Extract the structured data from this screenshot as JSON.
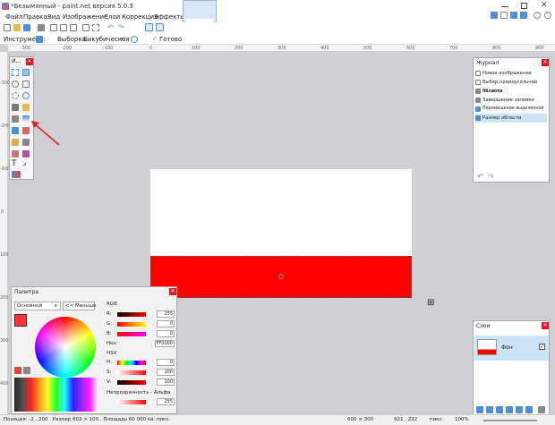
{
  "window": {
    "title": "*Безымянный - paint.net версия 5.0.3"
  },
  "menu": [
    "Файл",
    "Правка",
    "Вид",
    "Изображение",
    "Слои",
    "Коррекция",
    "Эффекты"
  ],
  "toolbar2": {
    "tool_label": "Инструмент:",
    "sampling_label": "Выборка:",
    "sampling_value": "Бикубическая",
    "done_label": "Готово"
  },
  "ruler": {
    "h_ticks": [
      "-300",
      "-200",
      "-100",
      "0",
      "100",
      "200",
      "300",
      "400",
      "500",
      "600",
      "700",
      "800",
      "900"
    ],
    "v_ticks": [
      "-300",
      "-200",
      "-100",
      "0",
      "100",
      "200",
      "300",
      "400",
      "500"
    ]
  },
  "tools": {
    "title": "И..."
  },
  "journal": {
    "title": "Журнал",
    "items": [
      "Новое изображение",
      "Выбор прямоугольной области",
      "Заливка",
      "Завершение заливки",
      "Перемещение выделенной области",
      "Размер области"
    ]
  },
  "layers": {
    "title": "Слои",
    "layer_name": "Фон"
  },
  "palette": {
    "title": "Палитра",
    "mode": "Основной",
    "less_button": "<< Меньше",
    "rgb_label": "RGB",
    "r_label": "R:",
    "r_value": "255",
    "g_label": "G:",
    "g_value": "0",
    "b_label": "B:",
    "b_value": "0",
    "hex_label": "Hex:",
    "hex_value": "FF0000",
    "hsv_label": "HSV",
    "h_label": "H:",
    "h_value": "0",
    "s_label": "S:",
    "s_value": "100",
    "v_label": "V:",
    "v_value": "100",
    "opacity_label": "Непрозрачность - Альфа",
    "opacity_value": "255",
    "primary_color": "#ff3333",
    "secondary_color": "#ffffff"
  },
  "status": {
    "position": "Позиция: -2 , 200 . Размер 602 × 100 . Площадь 60 000 кв. пикс.",
    "image_size": "600 × 300",
    "cursor": "921 , 222",
    "units": "пикс.",
    "zoom": "100%"
  },
  "colors": {
    "accent": "#4d8fd6",
    "annotation_arrow": "#e02020",
    "canvas_red": "#ff0000"
  }
}
